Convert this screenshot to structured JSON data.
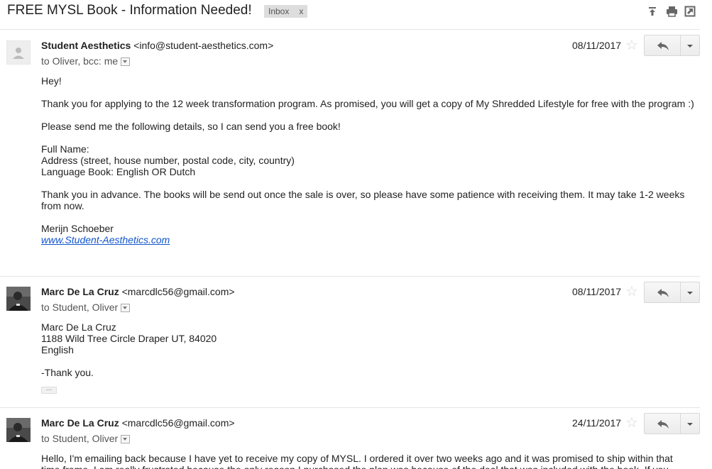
{
  "thread": {
    "subject": "FREE MYSL Book - Information Needed!",
    "label": "Inbox",
    "label_remove": "x",
    "actions": [
      "collapse-all-icon",
      "print-icon",
      "new-window-icon"
    ]
  },
  "messages": [
    {
      "sender_name": "Student Aesthetics",
      "sender_email": "<info@student-aesthetics.com>",
      "recipients": "to Oliver, bcc: me",
      "date": "08/11/2017",
      "body": [
        "Hey!",
        "Thank you for applying to the 12 week transformation program. As promised, you will get a copy of My Shredded Lifestyle for free with the program :)",
        "Please send me the following details, so I can send you a free book!",
        "Full Name:\nAddress (street, house number, postal code, city, country)\nLanguage Book: English OR Dutch",
        "Thank you in advance. The books will be send out once the sale is over, so please have some patience with receiving them. It may take 1-2 weeks from now.",
        "Merijn Schoeber"
      ],
      "link": "www.Student-Aesthetics.com"
    },
    {
      "sender_name": "Marc De La Cruz",
      "sender_email": "<marcdlc56@gmail.com>",
      "recipients": "to Student, Oliver",
      "date": "08/11/2017",
      "body": [
        "Marc De La Cruz\n1188 Wild Tree Circle Draper UT, 84020\nEnglish",
        "-Thank you."
      ],
      "trimmed": "..."
    },
    {
      "sender_name": "Marc De La Cruz",
      "sender_email": "<marcdlc56@gmail.com>",
      "recipients": "to Student, Oliver",
      "date": "24/11/2017",
      "body": [
        "Hello, I'm emailing back because I have yet to receive my copy of MYSL. I ordered it over two weeks ago and it was promised to ship within that time frame. I am really frustrated because the only reason I purchased the plan was because of the deal that was included with the book. If you"
      ]
    }
  ]
}
